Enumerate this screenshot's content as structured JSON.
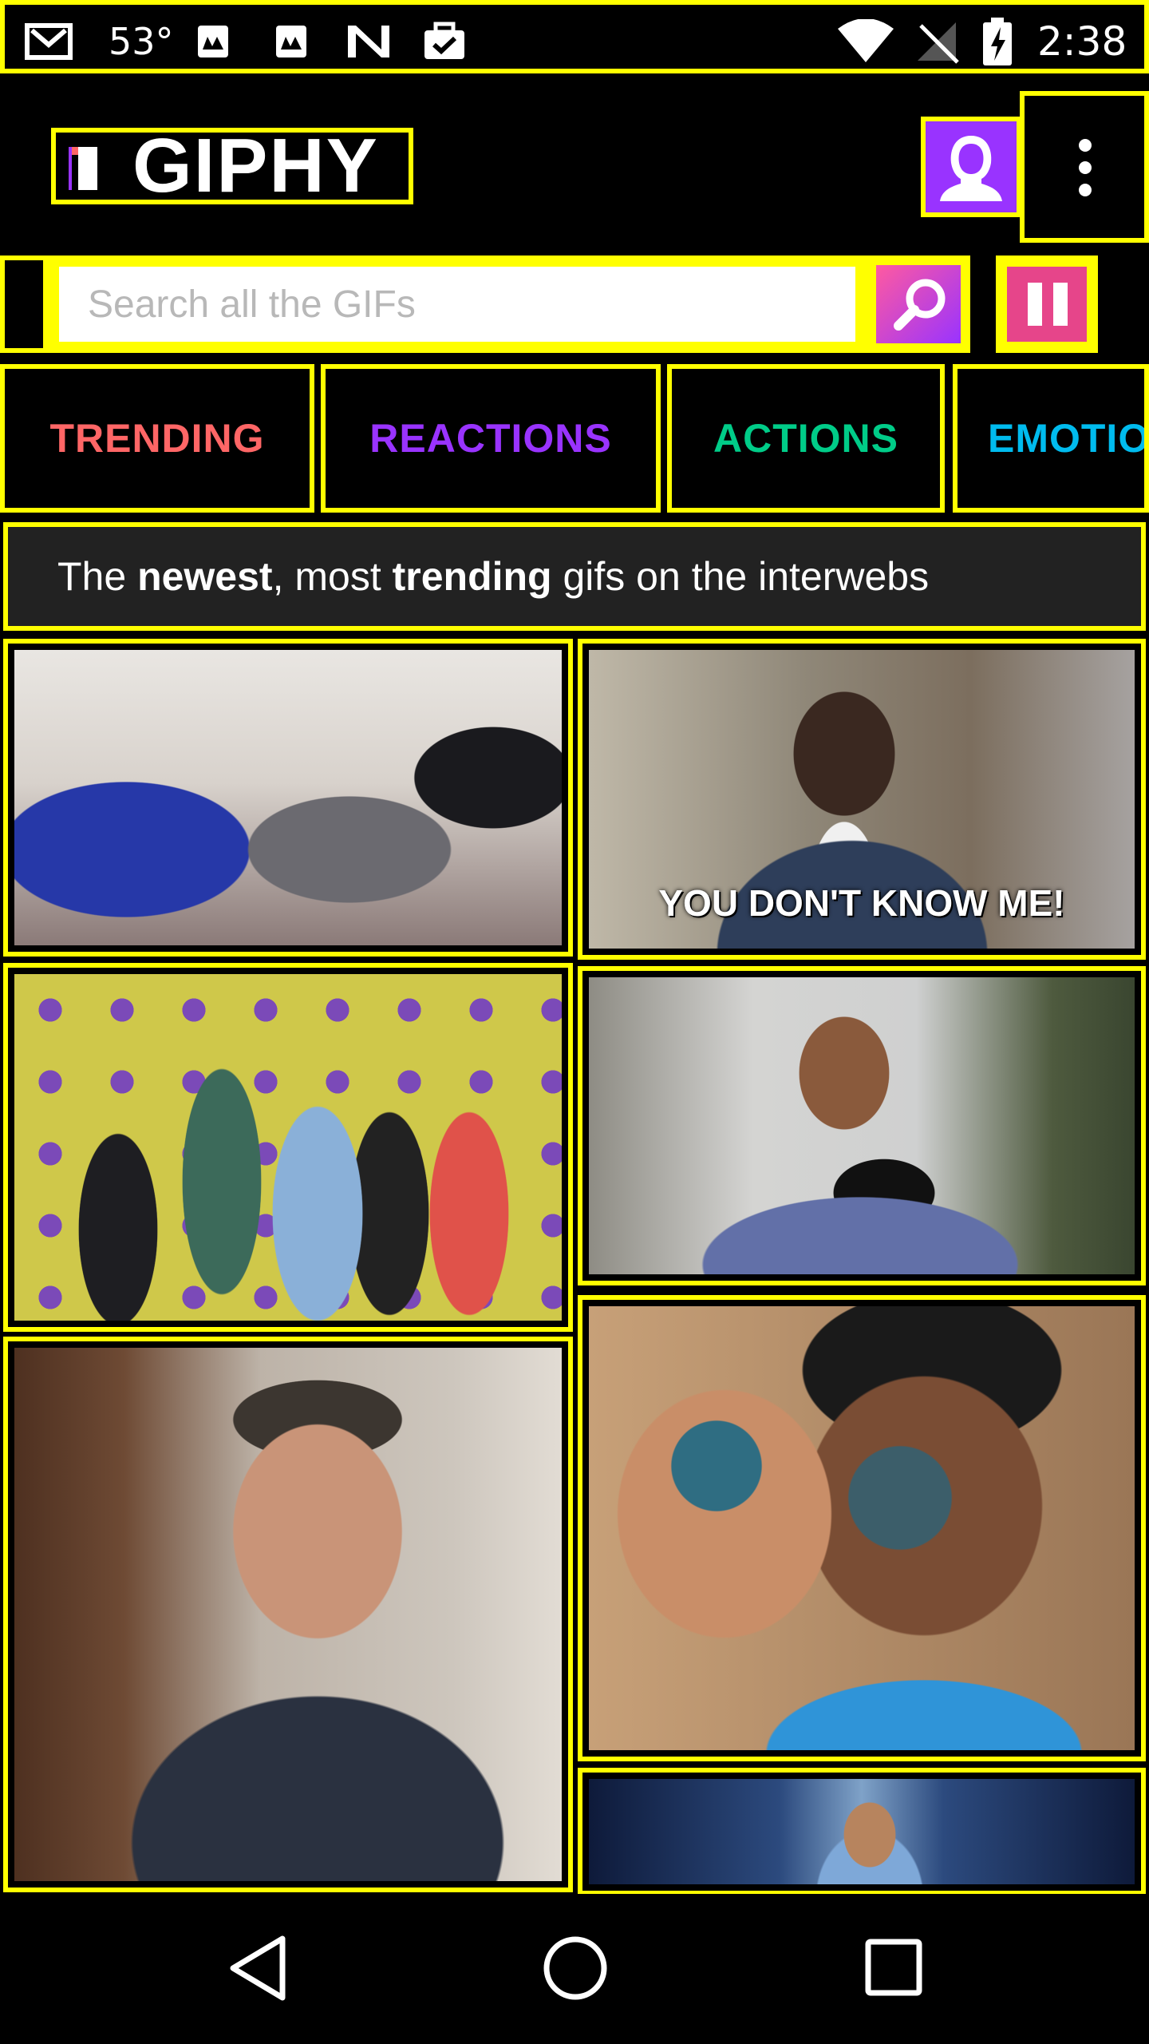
{
  "status_bar": {
    "temperature": "53°",
    "time": "2:38",
    "icons": [
      "gmail-icon",
      "weather-icon",
      "weather-icon",
      "n-app-icon",
      "briefcase-check-icon",
      "wifi-icon",
      "no-signal-icon",
      "battery-charging-icon"
    ]
  },
  "header": {
    "logo_text": "GIPHY",
    "avatar_icon": "person-icon",
    "more_icon": "more-vert-icon"
  },
  "search": {
    "placeholder": "Search all the GIFs",
    "search_icon": "magnifier-icon",
    "pause_icon": "pause-icon"
  },
  "tabs": [
    {
      "label": "TRENDING",
      "color": "#ff6666"
    },
    {
      "label": "REACTIONS",
      "color": "#9933ff"
    },
    {
      "label": "ACTIONS",
      "color": "#00cc88"
    },
    {
      "label": "EMOTIONS",
      "color": "#00bbee"
    }
  ],
  "banner": {
    "part1": "The ",
    "bold1": "newest",
    "part2": ", most ",
    "bold2": "trending",
    "part3": " gifs on the interwebs"
  },
  "gifs": [
    {
      "caption": ""
    },
    {
      "caption": "YOU DON'T KNOW ME!"
    },
    {
      "caption": ""
    },
    {
      "caption": ""
    },
    {
      "caption": ""
    },
    {
      "caption": ""
    },
    {
      "caption": ""
    }
  ],
  "nav": {
    "back_icon": "back-triangle-icon",
    "home_icon": "home-circle-icon",
    "recents_icon": "recents-square-icon"
  },
  "colors": {
    "highlight": "#ffff00",
    "background": "#000000",
    "purple": "#9933ff",
    "pink": "#e6458a"
  }
}
